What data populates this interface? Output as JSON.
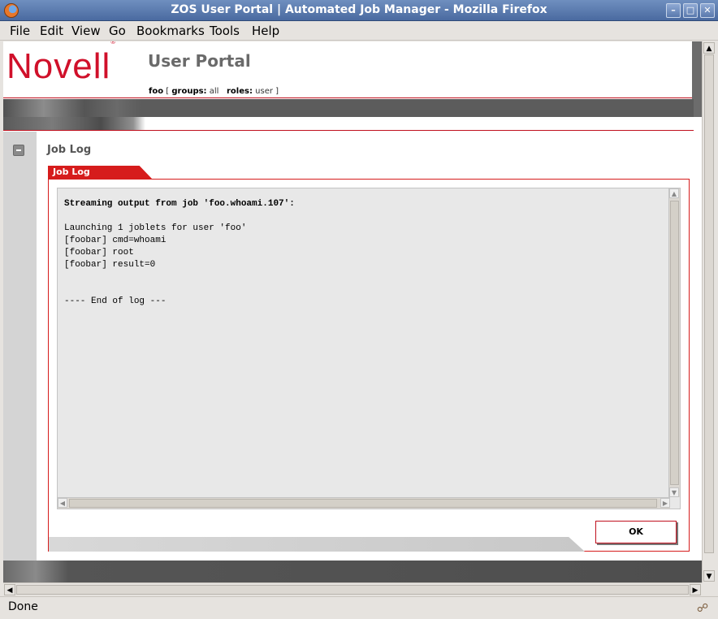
{
  "window": {
    "title": "ZOS User Portal | Automated Job Manager - Mozilla Firefox"
  },
  "menu": [
    "File",
    "Edit",
    "View",
    "Go",
    "Bookmarks",
    "Tools",
    "Help"
  ],
  "header": {
    "logo": "Novell",
    "logo_mark": "®",
    "portal_title": "User Portal",
    "user": "foo",
    "groups_label": "groups:",
    "groups_value": "all",
    "roles_label": "roles:",
    "roles_value": "user"
  },
  "section": {
    "title": "Job Log"
  },
  "tab": {
    "label": "Job Log"
  },
  "log": {
    "header": "Streaming output from job 'foo.whoami.107':",
    "lines": [
      "Launching 1 joblets for user 'foo'",
      "[foobar] cmd=whoami",
      "[foobar] root",
      "[foobar] result=0"
    ],
    "footer": "---- End of log ---"
  },
  "buttons": {
    "ok": "OK"
  },
  "status": {
    "text": "Done"
  },
  "colors": {
    "accent": "#d61c1c",
    "titlebar": "#5b7cb2"
  },
  "icons": {
    "app": "firefox-icon",
    "minimize": "minimize-icon",
    "maximize": "maximize-icon",
    "close": "close-icon",
    "collapse": "collapse-icon",
    "status": "connection-icon"
  }
}
